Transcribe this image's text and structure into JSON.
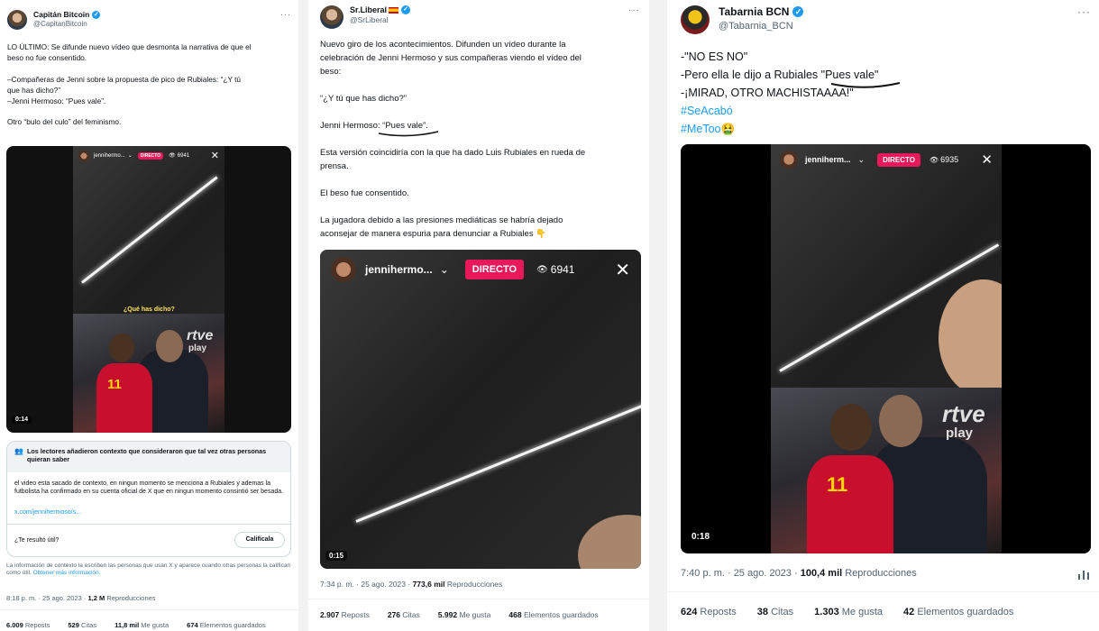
{
  "t1": {
    "name": "Capitán Bitcoin",
    "handle": "@CapitanBitcoin",
    "lines": [
      "LO ÚLTIMO: Se difunde nuevo vídeo que desmonta la narrativa de que el",
      "beso no fue consentido.",
      "",
      "–Compañeras de Jenni sobre la propuesta de pico de Rubiales: “¿Y tú",
      "que has dicho?”",
      "–Jenni Hermoso: “Pues vale”.",
      "",
      "Otro “bulo del culo” del feminismo."
    ],
    "live_user": "jennihermo...",
    "live_label": "DIRECTO",
    "viewers": "6941",
    "caption": "¿Qué has dicho?",
    "watermark": "rtve",
    "watermark2": "play",
    "jersey_number": "11",
    "video_time": "0:14",
    "note_title": "Los lectores añadieron contexto que consideraron que tal vez otras personas quieran saber",
    "note_body": "el video esta sacado de contexto, en ningun momento se menciona a Rubiales y ademas la futbolista ha confirmado en su cuenta oficial de X que en ningun momento consintió ser besada.",
    "note_link": "x.com/jennihermoso/s...",
    "helpful_q": "¿Te resultó útil?",
    "rate_btn": "Califícala",
    "disclaimer": "La información de contexto la escriben las personas que usan X y aparece cuando otras personas la califican como útil.",
    "disclaimer_link": "Obtener más información.",
    "time": "8:18 p. m. · 25 ago. 2023 ·",
    "views_num": "1,2 M",
    "views_lbl": "Reproducciones",
    "reposts_n": "6.009",
    "reposts_l": "Reposts",
    "quotes_n": "529",
    "quotes_l": "Citas",
    "likes_n": "11,8 mil",
    "likes_l": "Me gusta",
    "saves_n": "674",
    "saves_l": "Elementos guardados"
  },
  "t2": {
    "name": "Sr.Liberal",
    "handle": "@SrLiberal",
    "lines": [
      "Nuevo giro de los acontecimientos. Difunden un vídeo durante la",
      "celebración de Jenni Hermoso y sus compañeras viendo el vídeo del",
      "beso:",
      "",
      "“¿Y tú que has dicho?”",
      "",
      "Jenni Hermoso: “Pues vale”.",
      "",
      "Esta versión coincidiría con la que ha dado Luis Rubiales en rueda de",
      "prensa.",
      "",
      "El beso fue consentido.",
      "",
      "La jugadora debido a las presiones mediáticas se habría dejado",
      "aconsejar de manera espuria para denunciar a Rubiales 👇"
    ],
    "live_user": "jennihermo...",
    "live_label": "DIRECTO",
    "viewers": "6941",
    "video_time": "0:15",
    "time": "7:34 p. m. · 25 ago. 2023 ·",
    "views_num": "773,6 mil",
    "views_lbl": "Reproducciones",
    "reposts_n": "2.907",
    "reposts_l": "Reposts",
    "quotes_n": "276",
    "quotes_l": "Citas",
    "likes_n": "5.992",
    "likes_l": "Me gusta",
    "saves_n": "468",
    "saves_l": "Elementos guardados"
  },
  "t3": {
    "name": "Tabarnia BCN",
    "handle": "@Tabarnia_BCN",
    "lines": [
      "-\"NO ES NO\"",
      "-Pero ella le dijo a Rubiales \"Pues vale\"",
      "-¡MIRAD, OTRO MACHISTAAAA!\""
    ],
    "hashtags": [
      "#SeAcabó",
      "#MeToo🤮"
    ],
    "live_user": "jenniherm...",
    "live_label": "DIRECTO",
    "viewers": "6935",
    "watermark": "rtve",
    "watermark2": "play",
    "jersey_number": "11",
    "video_time": "0:18",
    "time": "7:40 p. m. · 25 ago. 2023 ·",
    "views_num": "100,4 mil",
    "views_lbl": "Reproducciones",
    "reposts_n": "624",
    "reposts_l": "Reposts",
    "quotes_n": "38",
    "quotes_l": "Citas",
    "likes_n": "1.303",
    "likes_l": "Me gusta",
    "saves_n": "42",
    "saves_l": "Elementos guardados"
  },
  "icons": {
    "more": "more-icon",
    "verified": "verified-badge-icon",
    "close": "close-icon",
    "eye": "eye-icon",
    "chevron": "chevron-down-icon",
    "community": "community-notes-icon",
    "analytics": "analytics-icon"
  },
  "colors": {
    "accent": "#1d9bf0",
    "live": "#e8195a",
    "jersey": "#c8102e"
  }
}
